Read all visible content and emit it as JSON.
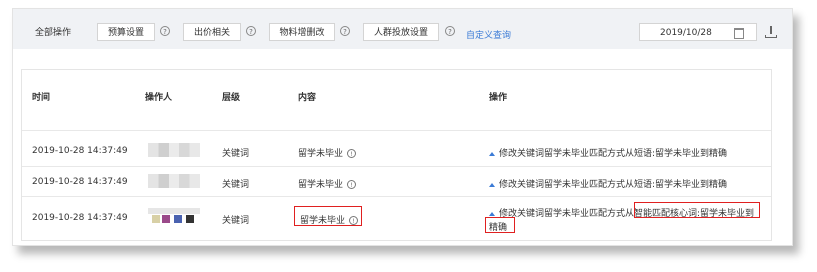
{
  "toolbar": {
    "all_ops": "全部操作",
    "budget": "预算设置",
    "bid": "出价相关",
    "material": "物料增删改",
    "audience": "人群投放设置",
    "custom_query": "自定义查询",
    "help_glyph": "?"
  },
  "date": {
    "value": "2019/10/28"
  },
  "columns": {
    "time": "时间",
    "operator": "操作人",
    "level": "层级",
    "content": "内容",
    "operation": "操作"
  },
  "rows": [
    {
      "time": "2019-10-28 14:37:49",
      "level": "关键词",
      "content": "留学未毕业",
      "op_line1": "修改关键词留学未毕业匹配方式从短语:留学未毕业到精确",
      "op_line2": ""
    },
    {
      "time": "2019-10-28 14:37:49",
      "level": "关键词",
      "content": "留学未毕业",
      "op_line1": "修改关键词留学未毕业匹配方式从短语:留学未毕业到精确",
      "op_line2": ""
    },
    {
      "time": "2019-10-28 14:37:49",
      "level": "关键词",
      "content": "留学未毕业",
      "op_line1a": "修改关键词留学未毕业匹配方式从",
      "op_line1b": "智能匹配核心词:留学未毕业到",
      "op_line2": "精确"
    }
  ],
  "info_glyph": "!"
}
